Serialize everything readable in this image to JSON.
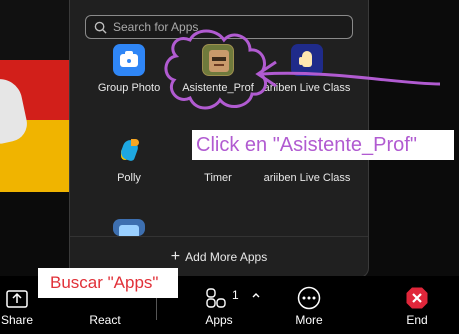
{
  "search": {
    "placeholder": "Search for Apps"
  },
  "apps": [
    {
      "label": "Group Photo",
      "icon": "camera-icon"
    },
    {
      "label": "Asistente_Prof",
      "icon": "professor-avatar-icon"
    },
    {
      "label": "ariiben Live Class",
      "icon": "raised-hand-icon"
    },
    {
      "label": "Polly",
      "icon": "parrot-icon"
    },
    {
      "label": "Timer",
      "icon": "timer-icon"
    },
    {
      "label": "ariiben Live Class",
      "icon": ""
    }
  ],
  "add_more_label": "Add More Apps",
  "annotations": {
    "click_note": "Click en \"Asistente_Prof\"",
    "search_note": "Buscar \"Apps\""
  },
  "toolbar": {
    "share": "Share",
    "react": "React",
    "apps": "Apps",
    "apps_badge": "1",
    "more": "More",
    "end": "End"
  },
  "colors": {
    "panel_bg": "#202020",
    "annotation_purple": "#b15bd1",
    "annotation_red": "#e13038",
    "end_red": "#e0263a"
  }
}
